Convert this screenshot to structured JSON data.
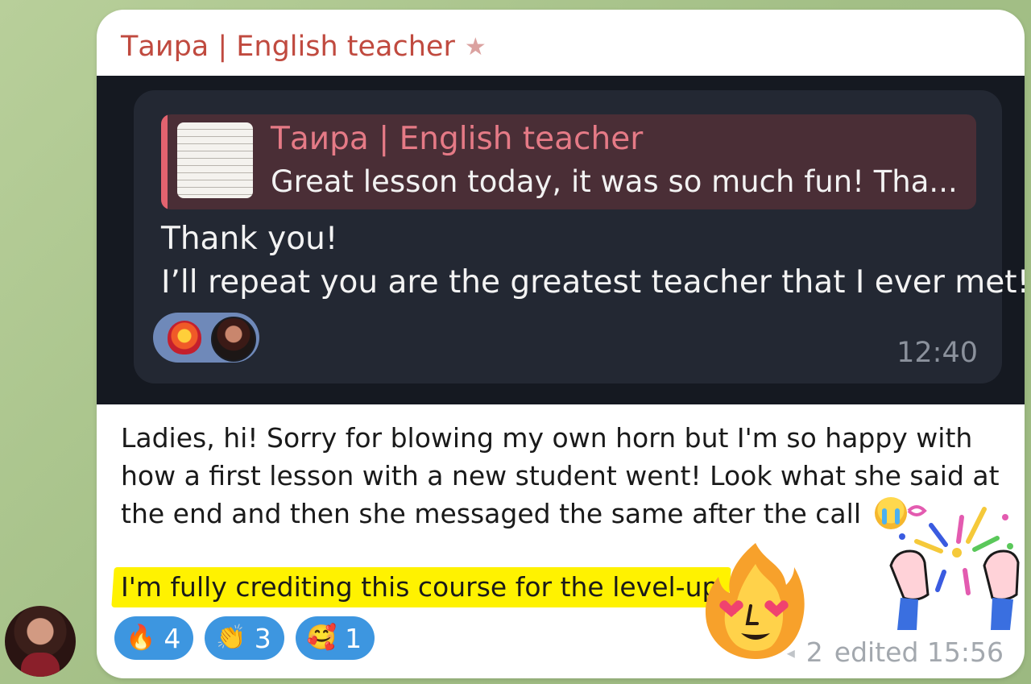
{
  "sender": {
    "name": "Таиpa | English teacher",
    "star_icon": "star-icon"
  },
  "screenshot": {
    "reply": {
      "name": "Таира | English teacher",
      "preview": "Great lesson today, it was so much fun! Tha..."
    },
    "message_line1": "Thank you!",
    "message_line2": "I’ll repeat you are the greatest teacher that I ever met!",
    "reaction_icon": "fire-heart-icon",
    "time": "12:40"
  },
  "message": {
    "line1": "Ladies, hi! Sorry for blowing my own horn but I'm so happy with",
    "line2": "how a first lesson with a new student went! Look what she said at",
    "line3": "the end and then she messaged the same after the call",
    "highlight": "I'm fully crediting this course for the level-up"
  },
  "reactions": [
    {
      "icon": "fire-icon",
      "glyph": "🔥",
      "count": "4"
    },
    {
      "icon": "clapping-hands-icon",
      "glyph": "👏",
      "count": "3"
    },
    {
      "icon": "smiling-face-with-hearts-icon",
      "glyph": "🥰",
      "count": "1"
    }
  ],
  "meta": {
    "replies": "2",
    "edited": "edited 15:56"
  },
  "colors": {
    "sender": "#c04a3f",
    "reaction_bg": "#3d96e0",
    "highlight": "#fff200",
    "dark_bg": "#151921"
  }
}
